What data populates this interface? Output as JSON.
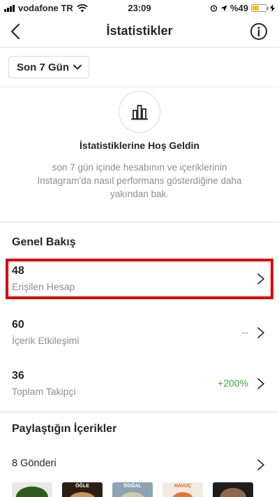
{
  "status_bar": {
    "carrier": "vodafone TR",
    "time": "23:09",
    "battery_percent": "%49",
    "battery_level": 0.49,
    "battery_color": "#f5c400"
  },
  "nav": {
    "title": "İstatistikler",
    "back_icon": "chevron-left-icon",
    "info_icon": "info-circle-icon"
  },
  "filter": {
    "selected": "Son 7 Gün"
  },
  "welcome": {
    "icon": "bar-chart-icon",
    "title": "İstatistiklerine Hoş Geldin",
    "description": "son 7 gün içinde hesabının ve içeriklerinin Instagram'da nasıl performans gösterdiğine daha yakından bak."
  },
  "overview": {
    "title": "Genel Bakış",
    "metrics": [
      {
        "value": "48",
        "label": "Erişilen Hesap",
        "change": "",
        "highlighted": true
      },
      {
        "value": "60",
        "label": "İçerik Etkileşimi",
        "change": "--"
      },
      {
        "value": "36",
        "label": "Toplam Takipçi",
        "change": "+200%"
      }
    ]
  },
  "content": {
    "title": "Paylaştığın İçerikler",
    "posts_label": "8 Gönderi",
    "thumbnail_labels": [
      "ÖĞLE",
      "DOĞAL",
      "HAVUÇ"
    ]
  },
  "colors": {
    "highlight": "#e00000",
    "positive": "#3dab3d",
    "muted": "#8e8e8e"
  }
}
